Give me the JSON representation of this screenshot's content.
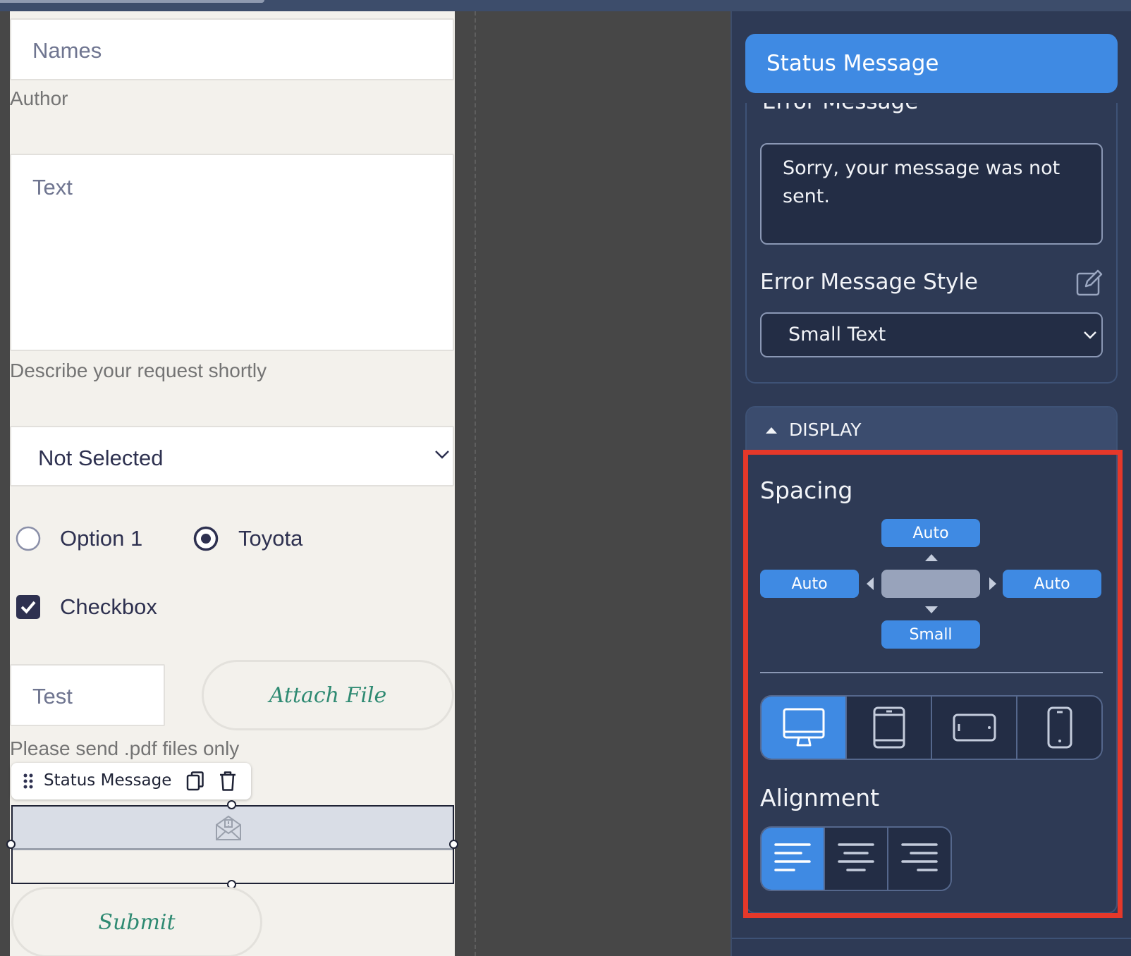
{
  "form": {
    "name_placeholder": "Names",
    "name_hint": "Author",
    "text_placeholder": "Text",
    "text_hint": "Describe your request shortly",
    "select_value": "Not Selected",
    "radio_option1": "Option 1",
    "radio_option2": "Toyota",
    "checkbox_label": "Checkbox",
    "test_placeholder": "Test",
    "attach_label": "Attach File",
    "attach_hint": "Please send .pdf files only",
    "status_toolbar_label": "Status Message",
    "submit_label": "Submit"
  },
  "panel": {
    "header_title": "Status Message",
    "error_message_label": "Error Message",
    "error_message_value": "Sorry, your message was not sent.",
    "error_style_label": "Error Message Style",
    "error_style_value": "Small Text",
    "display_label": "DISPLAY",
    "spacing_label": "Spacing",
    "spacing_top": "Auto",
    "spacing_left": "Auto",
    "spacing_right": "Auto",
    "spacing_bottom": "Small",
    "alignment_label": "Alignment",
    "selected_device": "desktop",
    "selected_alignment": "left"
  },
  "colors": {
    "accent": "#3f8ae3",
    "panel_bg": "#2e3a55",
    "highlight": "#e5382a",
    "form_text": "#2e3150",
    "button_text": "#2e8a72"
  },
  "icons": [
    "drag-handle-icon",
    "duplicate-icon",
    "trash-icon",
    "envelope-icon",
    "edit-icon",
    "chevron-down-icon",
    "caret-up-icon",
    "desktop-icon",
    "tablet-icon",
    "tablet-landscape-icon",
    "mobile-icon",
    "align-left-icon",
    "align-center-icon",
    "align-right-icon"
  ]
}
